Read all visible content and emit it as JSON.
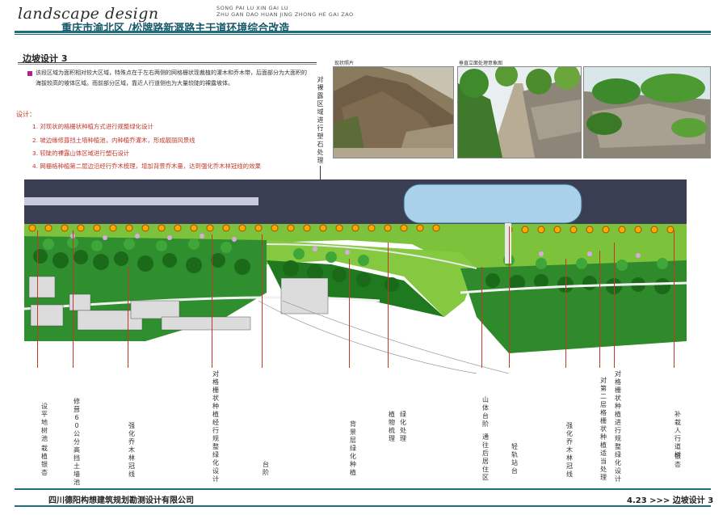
{
  "header": {
    "logo": "landscape design",
    "subtitle_line1": "SONG PAI LU  XIN GAI LU",
    "subtitle_line2": "ZHU GAN DAO HUAN JING ZHONG HE GAI ZAO",
    "title": "重庆市渝北区 /松牌路新溉路主干道环境综合改造"
  },
  "section": {
    "title": "边坡设计 3",
    "intro": "该段区域为面积相对较大区域，特殊点在于左右两侧的网格栅状现裁植的灌木和乔木带，后面部分为大面积的海拔较高的坡体区域。而前部分区域，靠近人行道侧也为大量较陡的裸露坡体。",
    "design_label": "设计：",
    "design_items": [
      "1. 对现状的格栅状种植方式进行规整绿化设计",
      "2. 坡边缘修葺挡土墙种植池，内种植乔灌木，形成靓丽风景线",
      "3. 较陡的裸露山体区域进行塑石设计",
      "4. 网栅格种植第二层边沿经行乔木梳理，增加背景乔木量，达到强化乔木林冠线的效果"
    ]
  },
  "photos": {
    "caption_left": "现状照片",
    "caption_right": "垂直立面处理意象图",
    "side_note": "对裸露区域进行塑石处理"
  },
  "labels": [
    "设平地树池",
    "栽植银杏",
    "修葺60公分高挡土墙池",
    "强化乔木林冠线",
    "对格栅状种植经行规整绿化设计",
    "台阶",
    "背景层绿化种植",
    "植物梳理",
    "绿化处理",
    "山体台阶",
    "通往后居住区",
    "轻轨站台",
    "强化乔木林冠线",
    "对第二层格栅状种植适当处理",
    "对格栅状种植进行规整绿化设计",
    "补栽人行道树",
    "银杏"
  ],
  "footer": {
    "company": "四川德阳构想建筑规划勘测设计有限公司",
    "page": "4.23 >>> 边坡设计 3"
  },
  "colors": {
    "accent": "#1d6f7d",
    "title_blue": "#17586a",
    "design_red": "#c0392b",
    "bullet_magenta": "#b0208c",
    "road": "#3a3e52",
    "grass": "#7cc23a",
    "tree_dark": "#1f7a1f"
  }
}
